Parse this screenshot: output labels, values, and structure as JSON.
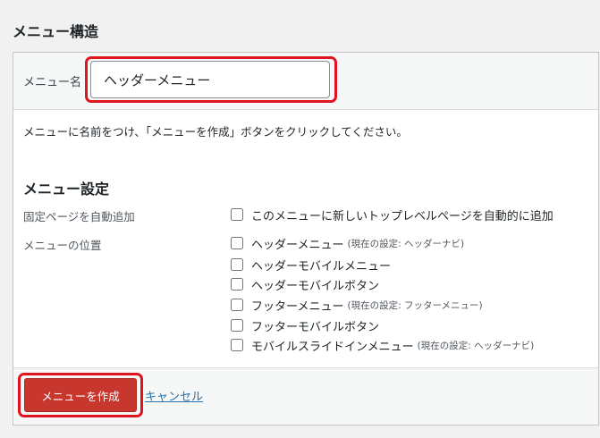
{
  "title": "メニュー構造",
  "menu_name": {
    "label": "メニュー名",
    "value": "ヘッダーメニュー"
  },
  "instructions": "メニューに名前をつけ、「メニューを作成」ボタンをクリックしてください。",
  "settings": {
    "title": "メニュー設定",
    "auto_add": {
      "label": "固定ページを自動追加",
      "option": "このメニューに新しいトップレベルページを自動的に追加"
    },
    "locations": {
      "label": "メニューの位置",
      "options": [
        {
          "label": "ヘッダーメニュー",
          "note": "(現在の設定: ヘッダーナビ)"
        },
        {
          "label": "ヘッダーモバイルメニュー",
          "note": ""
        },
        {
          "label": "ヘッダーモバイルボタン",
          "note": ""
        },
        {
          "label": "フッターメニュー",
          "note": "(現在の設定: フッターメニュー)"
        },
        {
          "label": "フッターモバイルボタン",
          "note": ""
        },
        {
          "label": "モバイルスライドインメニュー",
          "note": "(現在の設定: ヘッダーナビ)"
        }
      ]
    }
  },
  "footer": {
    "create_label": "メニューを作成",
    "cancel_label": "キャンセル"
  },
  "colors": {
    "highlight": "#e0141e",
    "primary_button": "#c8372d",
    "link": "#2271b1"
  }
}
